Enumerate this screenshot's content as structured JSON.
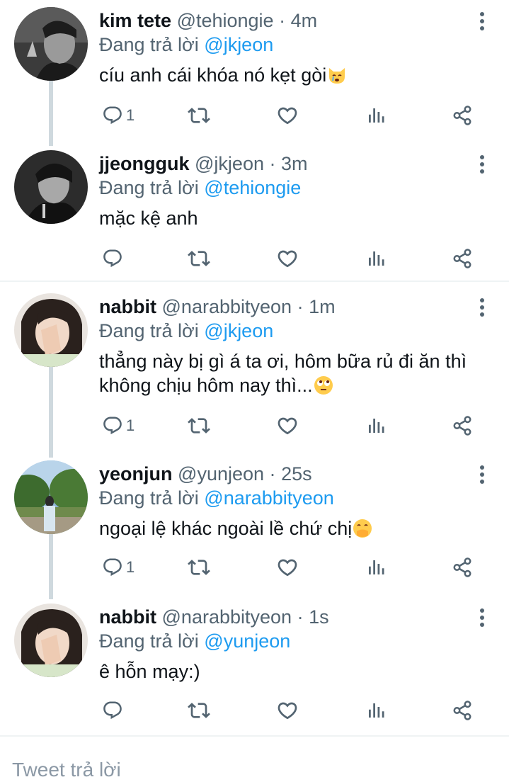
{
  "reply_prefix": "Đang trả lời",
  "tweets": [
    {
      "display_name": "kim tete",
      "handle": "@tehiongie",
      "separator": "·",
      "time": "4m",
      "replying_to": "@jkjeon",
      "text": "cíu anh cái khóa nó kẹt gòi",
      "emoji": "crying-cat-emoji",
      "reply_count": "1"
    },
    {
      "display_name": "jjeongguk",
      "handle": "@jkjeon",
      "separator": "·",
      "time": "3m",
      "replying_to": "@tehiongie",
      "text": "mặc kệ anh",
      "reply_count": ""
    },
    {
      "display_name": "nabbit",
      "handle": "@narabbityeon",
      "separator": "·",
      "time": "1m",
      "replying_to": "@jkjeon",
      "text_line1": "thẳng này bị gì á ta ơi, hôm bữa rủ đi ăn thì",
      "text_line2": "không chịu hôm nay thì...",
      "emoji": "eye-roll-emoji",
      "reply_count": "1"
    },
    {
      "display_name": "yeonjun",
      "handle": "@yunjeon",
      "separator": "·",
      "time": "25s",
      "replying_to": "@narabbityeon",
      "text": "ngoại lệ khác ngoài lề chứ chị",
      "emoji": "hand-over-mouth-emoji",
      "reply_count": "1"
    },
    {
      "display_name": "nabbit",
      "handle": "@narabbityeon",
      "separator": "·",
      "time": "1s",
      "replying_to": "@yunjeon",
      "text": "ê hỗn mạy:)",
      "reply_count": ""
    }
  ],
  "composer": {
    "placeholder": "Tweet trả lời"
  },
  "colors": {
    "primary_text": "#0f1419",
    "secondary_text": "#536471",
    "accent": "#1d9bf0",
    "thread_line": "#cfd9de",
    "divider": "#eff3f4"
  }
}
